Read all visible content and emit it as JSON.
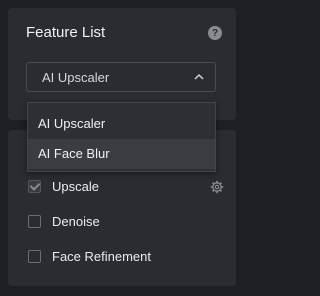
{
  "feature_panel": {
    "title": "Feature List",
    "help_glyph": "?",
    "select": {
      "value": "AI Upscaler",
      "icon": "chevron-up-icon"
    }
  },
  "dropdown": {
    "options": [
      "AI Upscaler",
      "AI Face Blur"
    ],
    "hovered_index": 1
  },
  "options_panel": {
    "items": [
      {
        "label": "Upscale",
        "checked": true,
        "disabled": true,
        "has_settings": true
      },
      {
        "label": "Denoise",
        "checked": false
      },
      {
        "label": "Face Refinement",
        "checked": false
      }
    ]
  },
  "colors": {
    "background": "#1e1f24",
    "panel": "#2b2c31",
    "text": "#e8e8e8"
  }
}
